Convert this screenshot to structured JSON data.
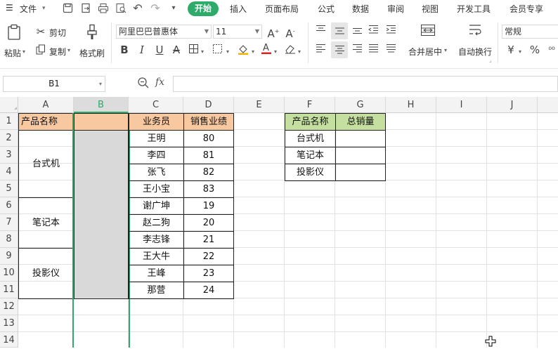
{
  "menubar": {
    "file_label": "文件",
    "tabs": [
      "开始",
      "插入",
      "页面布局",
      "公式",
      "数据",
      "审阅",
      "视图",
      "开发工具",
      "会员专享"
    ]
  },
  "ribbon": {
    "paste": "粘贴",
    "cut": "剪切",
    "copy": "复制",
    "format_painter": "格式刷",
    "font_name": "阿里巴巴普惠体",
    "font_size": "11",
    "merge_center": "合并居中",
    "wrap_text": "自动换行",
    "number_format": "常规"
  },
  "formula_bar": {
    "name_box": "B1",
    "fx": "fx",
    "value": ""
  },
  "columns": [
    "A",
    "B",
    "C",
    "D",
    "E",
    "F",
    "G",
    "H",
    "I",
    "J"
  ],
  "rows": [
    "1",
    "2",
    "3",
    "4",
    "5",
    "6",
    "7",
    "8",
    "9",
    "10",
    "11",
    "12",
    "13",
    "14"
  ],
  "table1": {
    "header_a": "产品名称",
    "header_b": "",
    "products": [
      "台式机",
      "笔记本",
      "投影仪"
    ]
  },
  "table2": {
    "header_salesperson": "业务员",
    "header_sales": "销售业绩",
    "rows": [
      {
        "name": "王明",
        "sales": "80"
      },
      {
        "name": "李四",
        "sales": "81"
      },
      {
        "name": "张飞",
        "sales": "82"
      },
      {
        "name": "王小宝",
        "sales": "83"
      },
      {
        "name": "谢广坤",
        "sales": "19"
      },
      {
        "name": "赵二狗",
        "sales": "20"
      },
      {
        "name": "李志锋",
        "sales": "21"
      },
      {
        "name": "王大牛",
        "sales": "22"
      },
      {
        "name": "王峰",
        "sales": "23"
      },
      {
        "name": "那营",
        "sales": "24"
      }
    ]
  },
  "table3": {
    "header_product": "产品名称",
    "header_total": "总销量",
    "products": [
      "台式机",
      "笔记本",
      "投影仪"
    ]
  },
  "colors": {
    "accent": "#2eaa6a",
    "header_orange": "#f8c8a0",
    "header_green": "#c5dfa0",
    "selected_col": "#d9d9d9"
  }
}
